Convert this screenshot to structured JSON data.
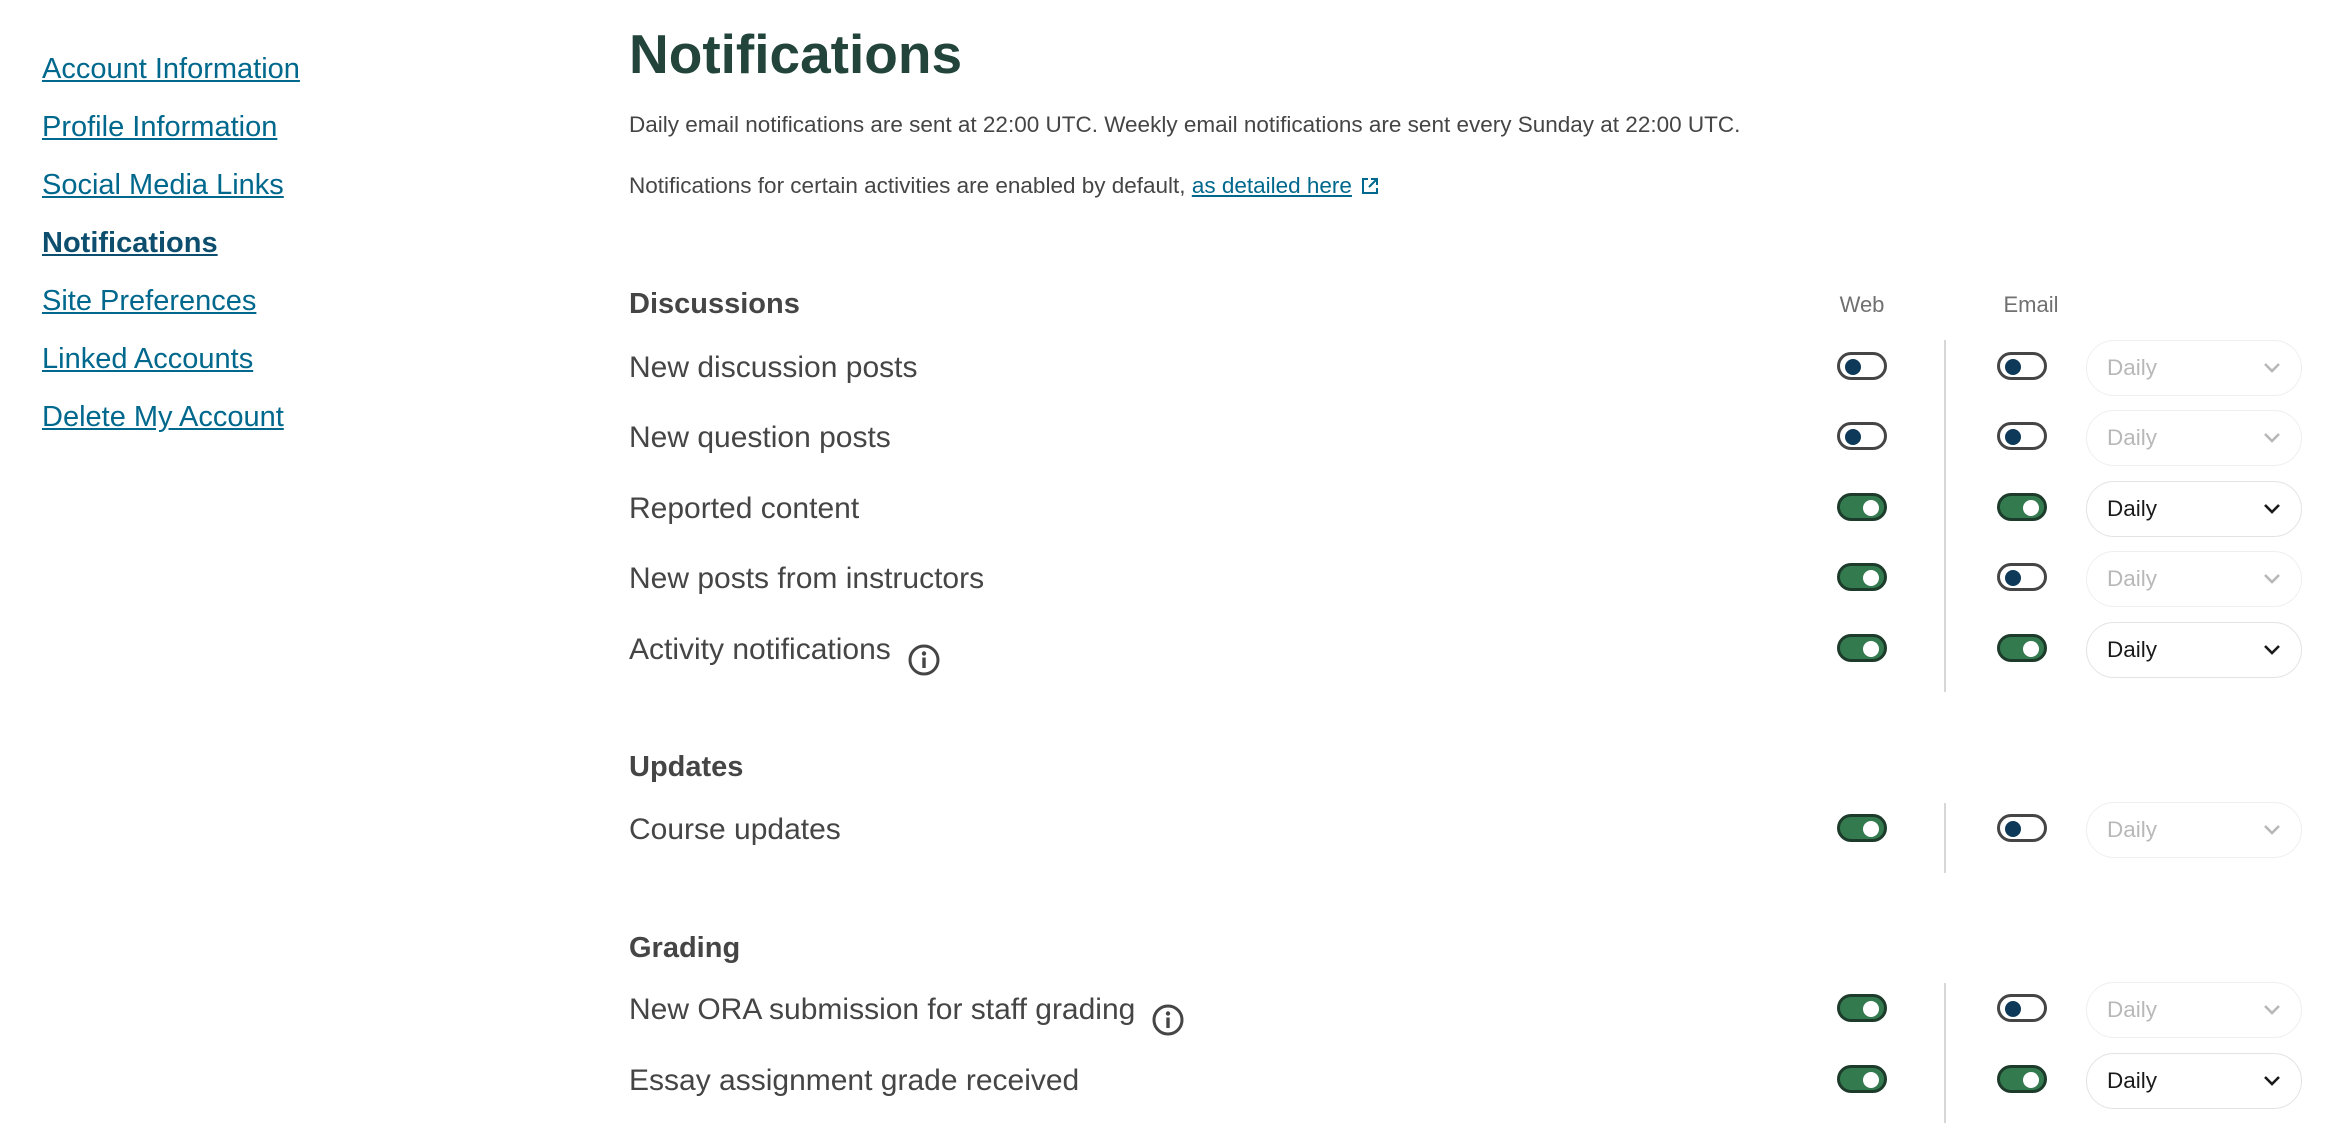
{
  "sidebar": {
    "items": [
      {
        "label": "Account Information",
        "active": false
      },
      {
        "label": "Profile Information",
        "active": false
      },
      {
        "label": "Social Media Links",
        "active": false
      },
      {
        "label": "Notifications",
        "active": true
      },
      {
        "label": "Site Preferences",
        "active": false
      },
      {
        "label": "Linked Accounts",
        "active": false
      },
      {
        "label": "Delete My Account",
        "active": false
      }
    ]
  },
  "page": {
    "title": "Notifications",
    "intro1": "Daily email notifications are sent at 22:00 UTC. Weekly email notifications are sent every Sunday at 22:00 UTC.",
    "intro2_prefix": "Notifications for certain activities are enabled by default,",
    "intro2_link": "as detailed here"
  },
  "columns": {
    "web": "Web",
    "email": "Email"
  },
  "sections": [
    {
      "title": "Discussions",
      "rows": [
        {
          "label": "New discussion posts",
          "info": false,
          "web": false,
          "email": false,
          "frequency": "Daily"
        },
        {
          "label": "New question posts",
          "info": false,
          "web": false,
          "email": false,
          "frequency": "Daily"
        },
        {
          "label": "Reported content",
          "info": false,
          "web": true,
          "email": true,
          "frequency": "Daily"
        },
        {
          "label": "New posts from instructors",
          "info": false,
          "web": true,
          "email": false,
          "frequency": "Daily"
        },
        {
          "label": "Activity notifications",
          "info": true,
          "web": true,
          "email": true,
          "frequency": "Daily"
        }
      ]
    },
    {
      "title": "Updates",
      "rows": [
        {
          "label": "Course updates",
          "info": false,
          "web": true,
          "email": false,
          "frequency": "Daily"
        }
      ]
    },
    {
      "title": "Grading",
      "rows": [
        {
          "label": "New ORA submission for staff grading",
          "info": true,
          "web": true,
          "email": false,
          "frequency": "Daily"
        },
        {
          "label": "Essay assignment grade received",
          "info": false,
          "web": true,
          "email": true,
          "frequency": "Daily"
        }
      ]
    }
  ],
  "colors": {
    "link": "#00688d",
    "title": "#22443a",
    "toggle_on": "#337a4f",
    "toggle_off_knob": "#0e3959"
  },
  "icons": {
    "external_link": "external-link-icon",
    "info": "info-icon",
    "chevron": "chevron-down-icon"
  }
}
